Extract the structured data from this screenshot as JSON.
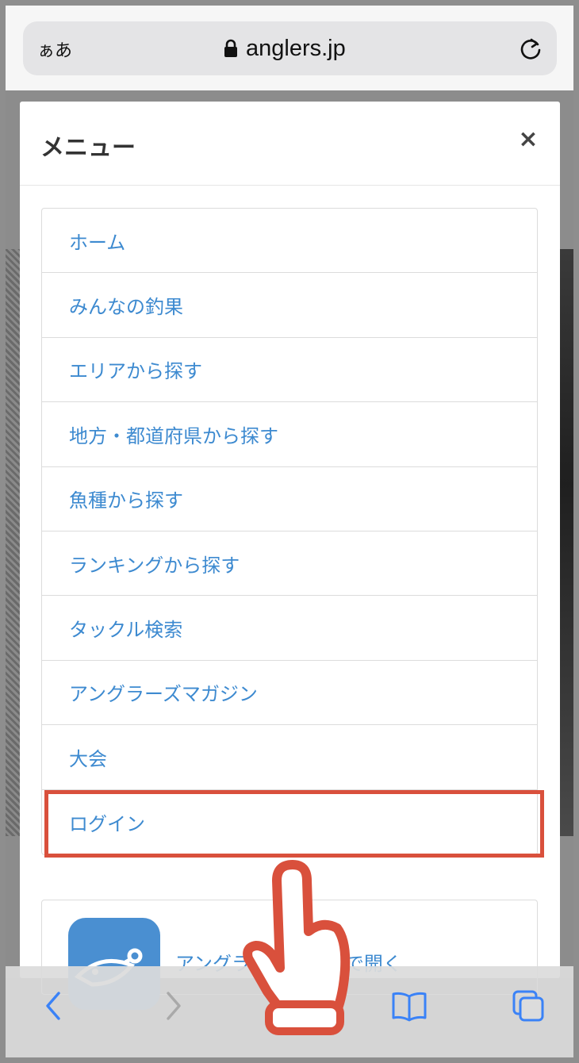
{
  "browser": {
    "text_size_label": "ぁあ",
    "url": "anglers.jp"
  },
  "modal": {
    "title": "メニュー",
    "close_label": "×",
    "menu_items": [
      "ホーム",
      "みんなの釣果",
      "エリアから探す",
      "地方・都道府県から探す",
      "魚種から探す",
      "ランキングから探す",
      "タックル検索",
      "アングラーズマガジン",
      "大会",
      "ログイン"
    ],
    "highlighted_item": "ログイン",
    "app_link": "アングラーズアプリで開く"
  },
  "colors": {
    "link": "#3d8ad0",
    "highlight": "#d9503c",
    "ios_blue": "#3a82f7"
  },
  "toolbar": {
    "icons": [
      "back-icon",
      "forward-icon",
      "share-icon",
      "bookmarks-icon",
      "tabs-icon"
    ]
  }
}
